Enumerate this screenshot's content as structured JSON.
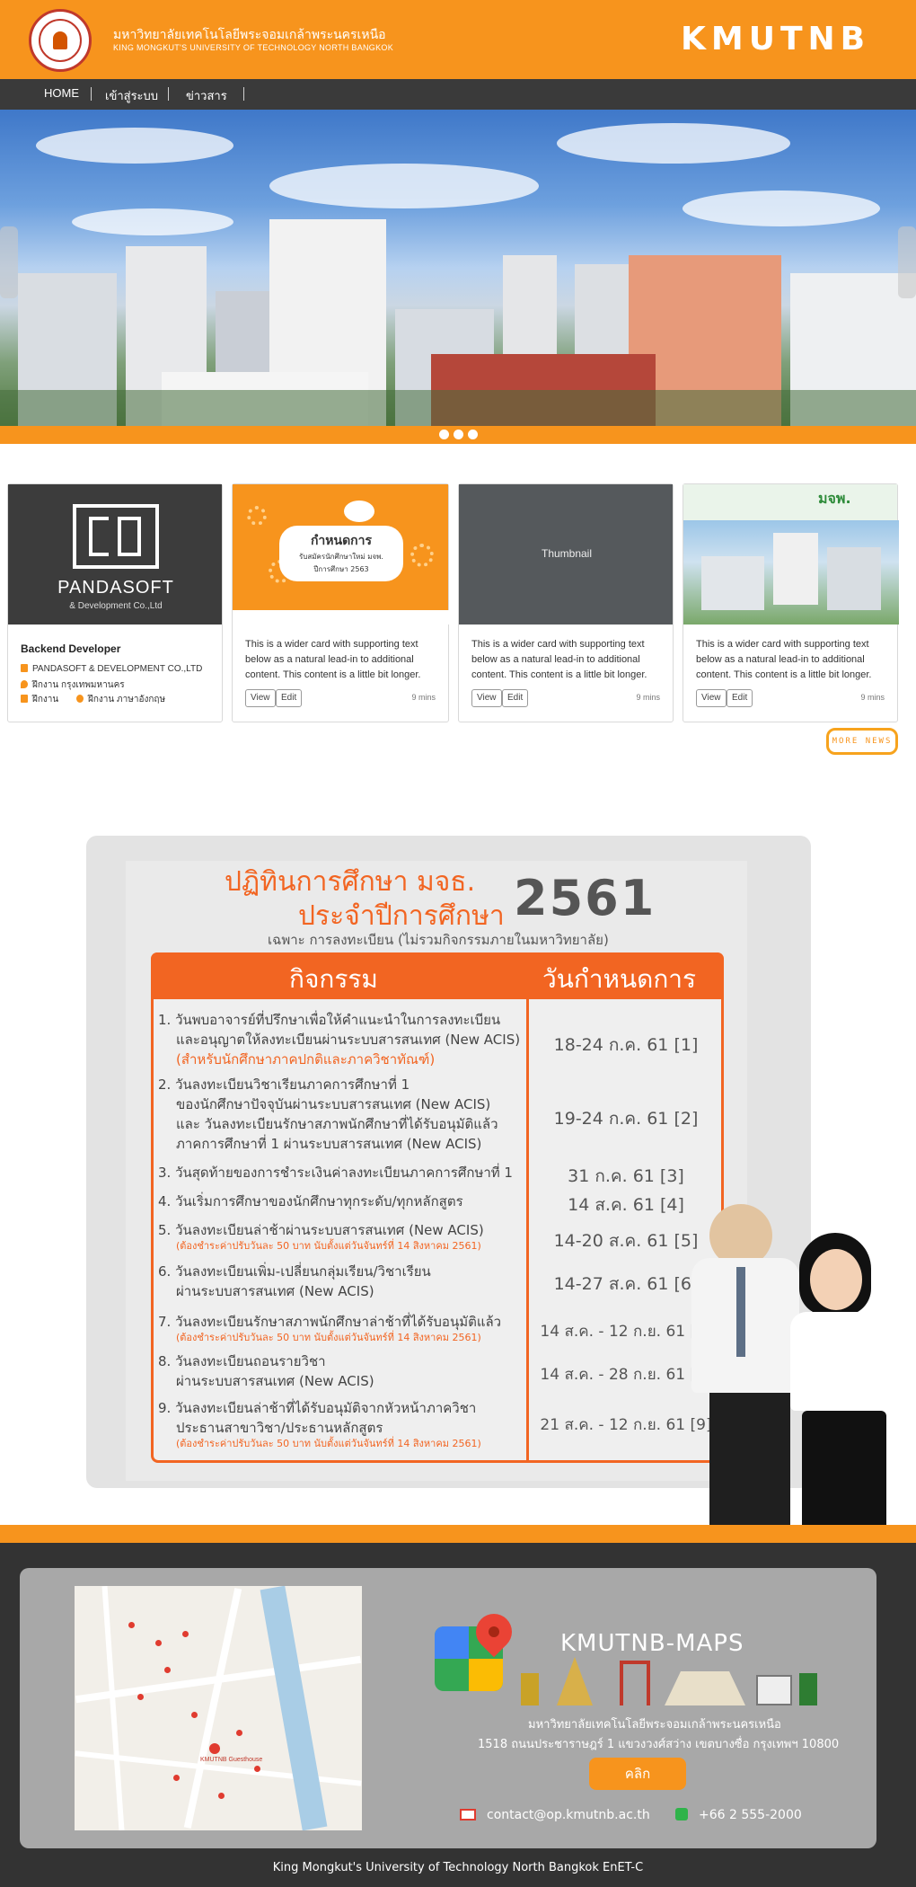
{
  "header": {
    "university_th": "มหาวิทยาลัยเทคโนโลยีพระจอมเกล้าพระนครเหนือ",
    "university_en": "KING MONGKUT'S UNIVERSITY OF TECHNOLOGY NORTH BANGKOK",
    "brand": "KMUTNB"
  },
  "nav": {
    "items": [
      {
        "label": "HOME"
      },
      {
        "label": "เข้าสู่ระบบ"
      },
      {
        "label": "ข่าวสาร"
      }
    ]
  },
  "cards": [
    {
      "type": "job",
      "logo_text": "PANDASOFT",
      "logo_sub": "& Development Co.,Ltd",
      "title": "Backend Developer",
      "company": "PANDASOFT & DEVELOPMENT CO.,LTD",
      "location": "ฝึกงาน กรุงเทพมหานคร",
      "type_label": "ฝึกงาน",
      "language": "ฝึกงาน ภาษาอังกฤษ"
    },
    {
      "type": "news",
      "img_title": "กำหนดการ",
      "img_line2": "รับสมัครนักศึกษาใหม่ มจพ.",
      "img_line3": "ปีการศึกษา 2563",
      "text": "This is a wider card with supporting text below as a natural lead-in to additional content. This content is a little bit longer.",
      "view": "View",
      "edit": "Edit",
      "time": "9 mins"
    },
    {
      "type": "news",
      "thumb": "Thumbnail",
      "text": "This is a wider card with supporting text below as a natural lead-in to additional content. This content is a little bit longer.",
      "view": "View",
      "edit": "Edit",
      "time": "9 mins"
    },
    {
      "type": "news",
      "img_title": "มจพ.",
      "text": "This is a wider card with supporting text below as a natural lead-in to additional content. This content is a little bit longer.",
      "view": "View",
      "edit": "Edit",
      "time": "9 mins"
    }
  ],
  "more_news": "MORE NEWS",
  "calendar": {
    "title_line1": "ปฏิทินการศึกษา มจธ.",
    "title_line2": "ประจำปีการศึกษา",
    "year": "2561",
    "subtitle": "เฉพาะ การลงทะเบียน (ไม่รวมกิจกรรมภายในมหาวิทยาลัย)",
    "col_activity": "กิจกรรม",
    "col_date": "วันกำหนดการ",
    "rows": [
      {
        "lines": [
          "1. วันพบอาจารย์ที่ปรึกษาเพื่อให้คำแนะนำในการลงทะเบียน",
          "และอนุญาตให้ลงทะเบียนผ่านระบบสารสนเทศ (New ACIS)"
        ],
        "highlight": "(สำหรับนักศึกษาภาคปกติและภาควิชาทัณฑ์)",
        "date": "18-24 ก.ค. 61 [1]"
      },
      {
        "lines": [
          "2. วันลงทะเบียนวิชาเรียนภาคการศึกษาที่ 1",
          "ของนักศึกษาปัจจุบันผ่านระบบสารสนเทศ (New ACIS)",
          "และ วันลงทะเบียนรักษาสภาพนักศึกษาที่ได้รับอนุมัติแล้ว",
          "ภาคการศึกษาที่ 1 ผ่านระบบสารสนเทศ (New ACIS)"
        ],
        "date": "19-24 ก.ค. 61 [2]"
      },
      {
        "lines": [
          "3. วันสุดท้ายของการชำระเงินค่าลงทะเบียนภาคการศึกษาที่ 1"
        ],
        "date": "31 ก.ค. 61 [3]"
      },
      {
        "lines": [
          "4. วันเริ่มการศึกษาของนักศึกษาทุกระดับ/ทุกหลักสูตร"
        ],
        "date": "14 ส.ค. 61 [4]"
      },
      {
        "lines": [
          "5. วันลงทะเบียนล่าช้าผ่านระบบสารสนเทศ (New ACIS)"
        ],
        "note": "(ต้องชำระค่าปรับวันละ 50 บาท นับตั้งแต่วันจันทร์ที่ 14 สิงหาคม 2561)",
        "date": "14-20 ส.ค. 61 [5]"
      },
      {
        "lines": [
          "6. วันลงทะเบียนเพิ่ม-เปลี่ยนกลุ่มเรียน/วิชาเรียน",
          "ผ่านระบบสารสนเทศ (New ACIS)"
        ],
        "date": "14-27 ส.ค. 61 [6]"
      },
      {
        "lines": [
          "7. วันลงทะเบียนรักษาสภาพนักศึกษาล่าช้าที่ได้รับอนุมัติแล้ว"
        ],
        "note": "(ต้องชำระค่าปรับวันละ 50 บาท นับตั้งแต่วันจันทร์ที่ 14 สิงหาคม 2561)",
        "date": "14 ส.ค. - 12 ก.ย. 61 [7]"
      },
      {
        "lines": [
          "8. วันลงทะเบียนถอนรายวิชา",
          "ผ่านระบบสารสนเทศ (New ACIS)"
        ],
        "date": "14 ส.ค. - 28 ก.ย. 61 [8]"
      },
      {
        "lines": [
          "9. วันลงทะเบียนล่าช้าที่ได้รับอนุมัติจากหัวหน้าภาควิชา",
          "ประธานสาขาวิชา/ประธานหลักสูตร"
        ],
        "note": "(ต้องชำระค่าปรับวันละ 50 บาท นับตั้งแต่วันจันทร์ที่ 14 สิงหาคม 2561)",
        "date": "21 ส.ค. - 12 ก.ย. 61 [9]"
      }
    ]
  },
  "footer": {
    "maps_title": "KMUTNB-MAPS",
    "map_label": "KMUTNB Guesthouse",
    "address_line1": "มหาวิทยาลัยเทคโนโลยีพระจอมเกล้าพระนครเหนือ",
    "address_line2": "1518 ถนนประชาราษฎร์ 1 แขวงวงศ์สว่าง เขตบางซื่อ กรุงเทพฯ 10800",
    "click_label": "คลิก",
    "email": "contact@op.kmutnb.ac.th",
    "phone": "+66 2 555-2000",
    "copyright": "King Mongkut's University of Technology North Bangkok EnET-C"
  },
  "colors": {
    "brand_orange": "#f7941d",
    "calendar_orange": "#f26522",
    "nav_dark": "#3a3a3a",
    "footer_dark": "#333333"
  },
  "icons": [
    "seal-logo",
    "building-icon",
    "location-pin-icon",
    "graduation-cap-icon",
    "chat-icon",
    "google-maps-icon",
    "mail-icon",
    "phone-icon"
  ]
}
